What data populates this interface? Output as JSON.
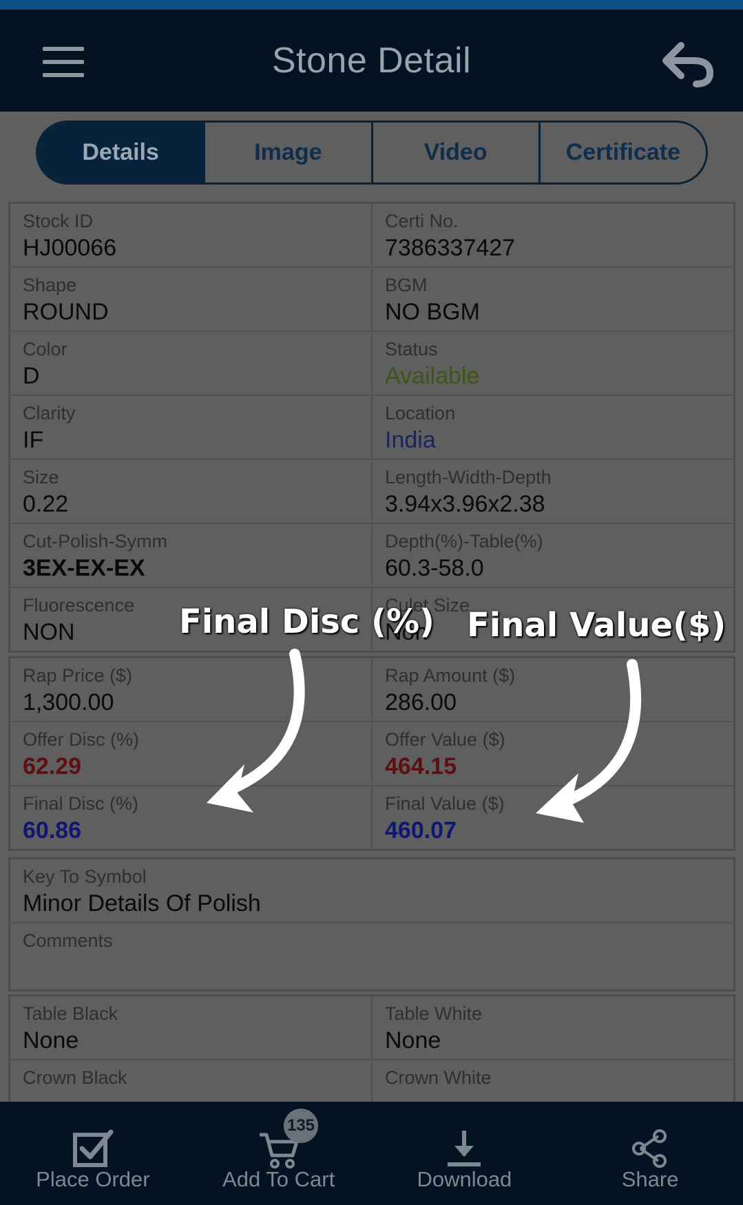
{
  "header": {
    "title": "Stone Detail",
    "menu_icon": "hamburger-menu-icon",
    "back_icon": "undo-arrow-icon"
  },
  "tabs": [
    {
      "label": "Details",
      "active": true
    },
    {
      "label": "Image",
      "active": false
    },
    {
      "label": "Video",
      "active": false
    },
    {
      "label": "Certificate",
      "active": false
    }
  ],
  "details": {
    "stock_id": {
      "label": "Stock ID",
      "value": "HJ00066"
    },
    "certi_no": {
      "label": "Certi No.",
      "value": "7386337427"
    },
    "shape": {
      "label": "Shape",
      "value": "ROUND"
    },
    "bgm": {
      "label": "BGM",
      "value": "NO BGM"
    },
    "color": {
      "label": "Color",
      "value": "D"
    },
    "status": {
      "label": "Status",
      "value": "Available"
    },
    "clarity": {
      "label": "Clarity",
      "value": "IF"
    },
    "location": {
      "label": "Location",
      "value": "India"
    },
    "size": {
      "label": "Size",
      "value": "0.22"
    },
    "lwd": {
      "label": "Length-Width-Depth",
      "value": "3.94x3.96x2.38"
    },
    "cps": {
      "label": "Cut-Polish-Symm",
      "value": "3EX-EX-EX"
    },
    "depth_table": {
      "label": "Depth(%)-Table(%)",
      "value": "60.3-58.0"
    },
    "fluorescence": {
      "label": "Fluorescence",
      "value": "NON"
    },
    "culet": {
      "label": "Culet Size",
      "value": "Non"
    }
  },
  "pricing": {
    "rap_price": {
      "label": "Rap Price ($)",
      "value": "1,300.00"
    },
    "rap_amount": {
      "label": "Rap Amount ($)",
      "value": "286.00"
    },
    "offer_disc": {
      "label": "Offer Disc (%)",
      "value": "62.29"
    },
    "offer_value": {
      "label": "Offer Value ($)",
      "value": "464.15"
    },
    "final_disc": {
      "label": "Final Disc (%)",
      "value": "60.86"
    },
    "final_value": {
      "label": "Final Value ($)",
      "value": "460.07"
    }
  },
  "notes": {
    "key_to_symbol": {
      "label": "Key To Symbol",
      "value": "Minor Details Of Polish"
    },
    "comments": {
      "label": "Comments",
      "value": ""
    }
  },
  "inclusions": {
    "table_black": {
      "label": "Table Black",
      "value": "None"
    },
    "table_white": {
      "label": "Table White",
      "value": "None"
    },
    "crown_black": {
      "label": "Crown Black",
      "value": ""
    },
    "crown_white": {
      "label": "Crown White",
      "value": ""
    }
  },
  "annotations": {
    "final_disc": "Final Disc (%)",
    "final_value": "Final Value($)"
  },
  "bottom_nav": {
    "place_order": "Place Order",
    "add_to_cart": "Add To Cart",
    "cart_count": "135",
    "download": "Download",
    "share": "Share"
  },
  "colors": {
    "header_bg": "#031322",
    "status_available": "#3c5614",
    "location_link": "#1c2460",
    "offer_red": "#5d0f12",
    "final_navy": "#0f1770"
  }
}
